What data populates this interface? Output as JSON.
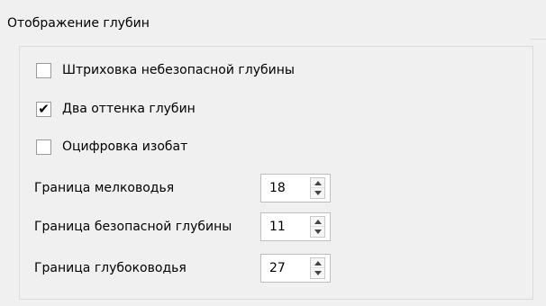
{
  "group": {
    "title": "Отображение глубин"
  },
  "checkboxes": [
    {
      "label": "Штриховка небезопасной глубины",
      "checked": false,
      "mark": ""
    },
    {
      "label": "Два оттенка глубин",
      "checked": true,
      "mark": "✔"
    },
    {
      "label": "Оцифровка изобат",
      "checked": false,
      "mark": ""
    }
  ],
  "fields": [
    {
      "label": "Граница мелководья",
      "value": "18"
    },
    {
      "label": "Граница безопасной глубины",
      "value": "11"
    },
    {
      "label": "Граница глубоководья",
      "value": "27"
    }
  ],
  "colors": {
    "panel_background": "#f0f0f0",
    "frame_border": "#dcdcdc"
  }
}
